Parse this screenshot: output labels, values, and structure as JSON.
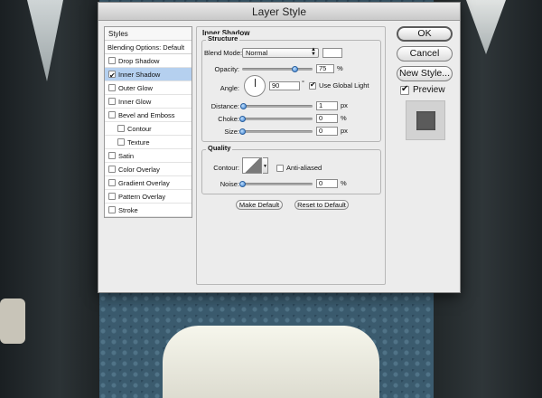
{
  "window": {
    "title": "Layer Style"
  },
  "styles_list": {
    "header": "Styles",
    "blending_options": "Blending Options: Default",
    "items": [
      {
        "label": "Drop Shadow",
        "checked": false,
        "selected": false,
        "indent": false
      },
      {
        "label": "Inner Shadow",
        "checked": true,
        "selected": true,
        "indent": false
      },
      {
        "label": "Outer Glow",
        "checked": false,
        "selected": false,
        "indent": false
      },
      {
        "label": "Inner Glow",
        "checked": false,
        "selected": false,
        "indent": false
      },
      {
        "label": "Bevel and Emboss",
        "checked": false,
        "selected": false,
        "indent": false
      },
      {
        "label": "Contour",
        "checked": false,
        "selected": false,
        "indent": true
      },
      {
        "label": "Texture",
        "checked": false,
        "selected": false,
        "indent": true
      },
      {
        "label": "Satin",
        "checked": false,
        "selected": false,
        "indent": false
      },
      {
        "label": "Color Overlay",
        "checked": false,
        "selected": false,
        "indent": false
      },
      {
        "label": "Gradient Overlay",
        "checked": false,
        "selected": false,
        "indent": false
      },
      {
        "label": "Pattern Overlay",
        "checked": false,
        "selected": false,
        "indent": false
      },
      {
        "label": "Stroke",
        "checked": false,
        "selected": false,
        "indent": false
      }
    ]
  },
  "panel": {
    "title": "Inner Shadow",
    "structure": {
      "title": "Structure",
      "blend_mode_label": "Blend Mode:",
      "blend_mode_value": "Normal",
      "opacity_label": "Opacity:",
      "opacity_value": "75",
      "opacity_level": 0.75,
      "percent": "%",
      "angle_label": "Angle:",
      "angle_value": "90",
      "degree": "°",
      "use_global_light_label": "Use Global Light",
      "distance_label": "Distance:",
      "distance_value": "1",
      "px": "px",
      "choke_label": "Choke:",
      "choke_value": "0",
      "size_label": "Size:",
      "size_value": "0"
    },
    "quality": {
      "title": "Quality",
      "contour_label": "Contour:",
      "anti_aliased_label": "Anti-aliased",
      "noise_label": "Noise:",
      "noise_value": "0",
      "percent": "%"
    },
    "make_default": "Make Default",
    "reset_to_default": "Reset to Default"
  },
  "buttons": {
    "ok": "OK",
    "cancel": "Cancel",
    "new_style": "New Style...",
    "preview_label": "Preview"
  },
  "colors": {
    "selection": "#b5d0ef",
    "dialog_bg": "#ececec",
    "slider_thumb": "#3a7fd0"
  }
}
